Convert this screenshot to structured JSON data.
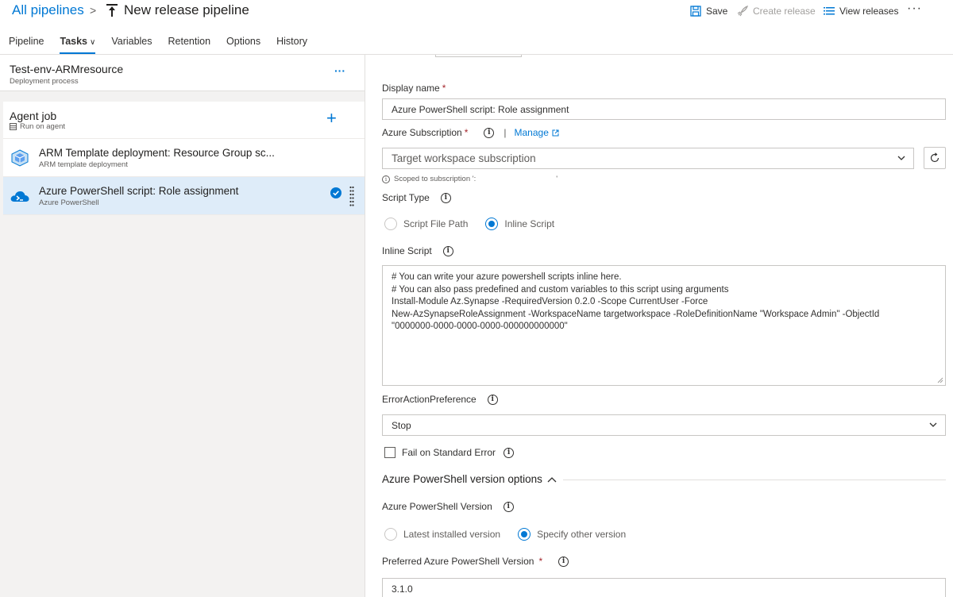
{
  "header": {
    "breadcrumb_link": "All pipelines",
    "breadcrumb_sep": ">",
    "pipeline_title": "New release pipeline",
    "save_label": "Save",
    "create_release_label": "Create release",
    "view_releases_label": "View releases",
    "more_label": "···"
  },
  "tabs": [
    {
      "label": "Pipeline"
    },
    {
      "label": "Tasks",
      "active": true
    },
    {
      "label": "Variables"
    },
    {
      "label": "Retention"
    },
    {
      "label": "Options"
    },
    {
      "label": "History"
    }
  ],
  "left": {
    "process_name": "Test-env-ARMresource",
    "process_sub": "Deployment process",
    "process_more": "···",
    "agent_job_title": "Agent job",
    "agent_job_sub": "Run on agent",
    "add_label": "+",
    "tasks": [
      {
        "title": "ARM Template deployment: Resource Group sc...",
        "sub": "ARM template deployment",
        "icon": "arm-template-icon"
      },
      {
        "title": "Azure PowerShell script: Role assignment",
        "sub": "Azure PowerShell",
        "icon": "azure-powershell-icon",
        "selected": true
      }
    ]
  },
  "form": {
    "display_name_label": "Display name",
    "required_mark": "*",
    "display_name_value": "Azure PowerShell script: Role assignment",
    "subscription_label": "Azure Subscription",
    "manage_label": "Manage",
    "separator": "|",
    "subscription_value": "Target workspace subscription",
    "scoped_text": "Scoped to subscription ':",
    "scoped_tail": "'",
    "script_type_label": "Script Type",
    "script_type_options": [
      {
        "label": "Script File Path",
        "selected": false
      },
      {
        "label": "Inline Script",
        "selected": true
      }
    ],
    "inline_script_label": "Inline Script",
    "inline_script_lines": [
      "# You can write your azure powershell scripts inline here.",
      "# You can also pass predefined and custom variables to this script using arguments",
      "Install-Module Az.Synapse -RequiredVersion 0.2.0 -Scope CurrentUser -Force",
      "New-AzSynapseRoleAssignment -WorkspaceName targetworkspace -RoleDefinitionName \"Workspace Admin\" -ObjectId",
      "\"0000000-0000-0000-0000-000000000000\""
    ],
    "error_pref_label": "ErrorActionPreference",
    "error_pref_value": "Stop",
    "fail_std_error_label": "Fail on Standard Error",
    "fail_std_error_checked": false,
    "version_section_label": "Azure PowerShell version options",
    "ps_version_label": "Azure PowerShell Version",
    "ps_version_options": [
      {
        "label": "Latest installed version",
        "selected": false
      },
      {
        "label": "Specify other version",
        "selected": true
      }
    ],
    "preferred_version_label": "Preferred Azure PowerShell Version",
    "preferred_version_value": "3.1.0",
    "info_glyph": "i"
  },
  "colors": {
    "accent": "#0078d4",
    "selected_bg": "#deecf9",
    "required": "#a4262c"
  }
}
